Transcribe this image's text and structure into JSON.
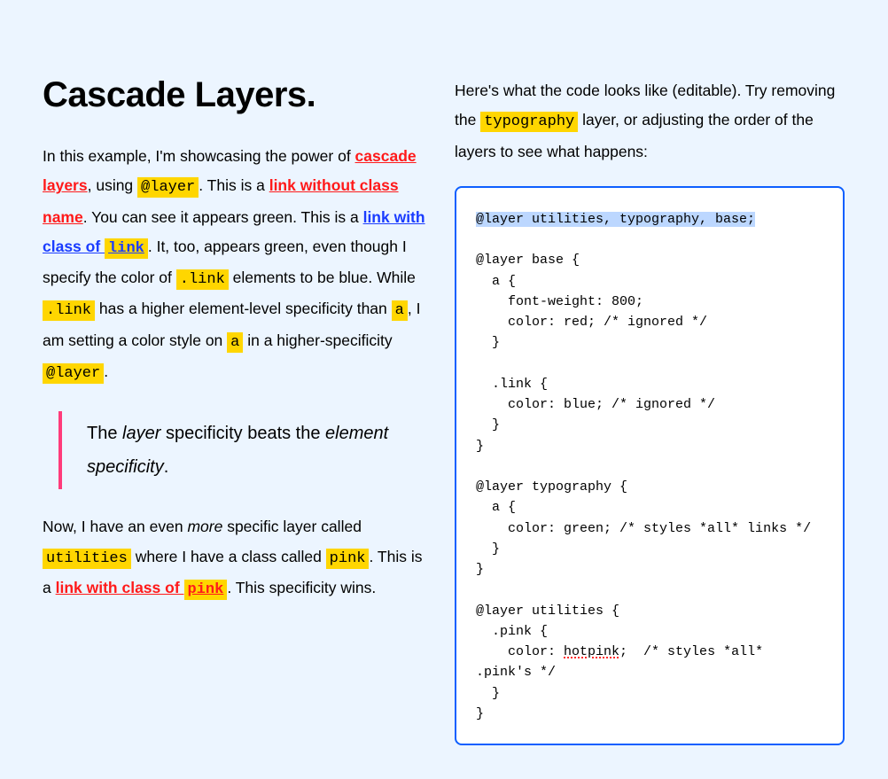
{
  "left": {
    "heading": "Cascade Layers.",
    "p1_a": "In this example, I'm showcasing the power of ",
    "link_cascade": "cascade layers",
    "p1_b": ", using ",
    "code_layer": "@layer",
    "p1_c": ". This is a ",
    "link_noclass": "link without class name",
    "p1_d": ". You can see it appears green. This is a ",
    "link_withclass_pre": "link with class of ",
    "code_link": "link",
    "p1_e": ". It, too, appears green, even though I specify the color of ",
    "code_dotlink1": ".link",
    "p1_f": " elements to be blue. While ",
    "code_dotlink2": ".link",
    "p1_g": " has a higher element-level specificity than ",
    "code_a1": "a",
    "p1_h": ", I am setting a color style on ",
    "code_a2": "a",
    "p1_i": " in a higher-specificity ",
    "code_layer2": "@layer",
    "p1_j": ".",
    "bq_a": "The ",
    "bq_em1": "layer",
    "bq_b": " specificity beats the ",
    "bq_em2": "element specificity",
    "bq_c": ".",
    "p2_a": "Now, I have an even ",
    "p2_em": "more",
    "p2_b": " specific layer called ",
    "code_utilities": "utilities",
    "p2_c": " where I have a class called ",
    "code_pink": "pink",
    "p2_d": ". This is a ",
    "link_pink_pre": "link with class of ",
    "code_pink2": "pink",
    "p2_e": ". This specificity wins."
  },
  "right": {
    "intro_a": "Here's what the code looks like (editable). Try removing the ",
    "code_typography": "typography",
    "intro_b": " layer, or adjusting the order of the layers to see what happens:",
    "code_line_sel": "@layer utilities, typography, base;",
    "code_block_a": "\n\n@layer base {\n  a {\n    font-weight: 800;\n    color: red; /* ignored */\n  }\n\n  .link {\n    color: blue; /* ignored */\n  }\n}\n\n@layer typography {\n  a {\n    color: green; /* styles *all* links */\n  }\n}\n\n@layer utilities {\n  .pink {\n    color: ",
    "hotpink": "hotpink",
    "code_block_b": ";  /* styles *all* .pink's */\n  }\n}"
  }
}
